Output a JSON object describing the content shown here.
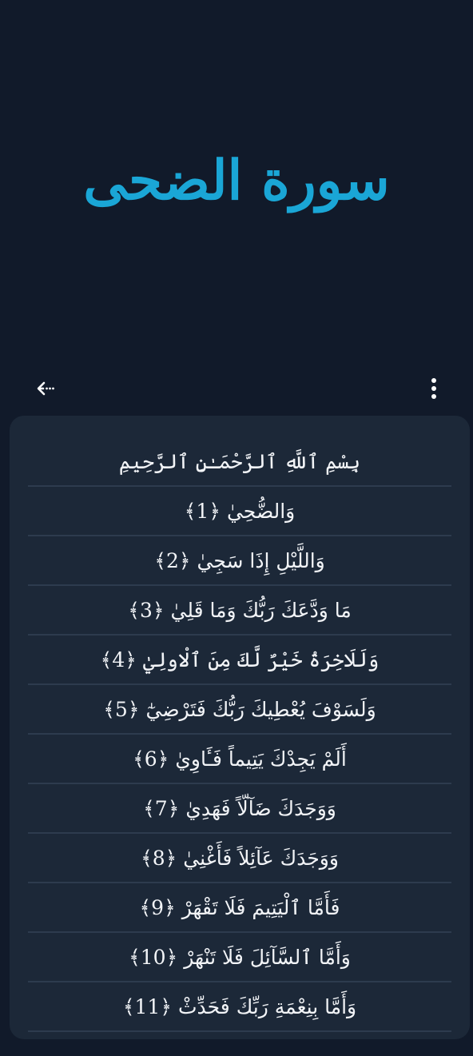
{
  "header": {
    "surah_title": "سورة الضحى"
  },
  "toolbar": {
    "back_icon": "back-arrow-icon",
    "menu_icon": "more-vertical-icon"
  },
  "ayahs": [
    {
      "text": "بِسْمِ ٱللَّهِ ٱلرَّحْمَـٰنِ ٱلرَّحِيمِ",
      "number": ""
    },
    {
      "text": "وَالضُّحِيٰ",
      "number": "﴿1﴾"
    },
    {
      "text": "وَاللَّيْلِ إِذَا سَجِيٰ",
      "number": "﴿2﴾"
    },
    {
      "text": "مَا وَدَّعَكَ رَبُّكَ وَمَا قَلِيٰ",
      "number": "﴿3﴾"
    },
    {
      "text": "وَلَلَاخِرَةُ خَيْرٌ لَّكَ مِنَ ٱلْاولِيٰ",
      "number": "﴿4﴾"
    },
    {
      "text": "وَلَسَوْفَ يُعْطِيكَ رَبُّكَ فَتَرْضِيٰٓ",
      "number": "﴿5﴾"
    },
    {
      "text": "أَلَمْ يَجِدْكَ يَتِيماً فَـَٔاوِيٰ",
      "number": "﴿6﴾"
    },
    {
      "text": "وَوَجَدَكَ ضَآلّاً فَهَدِيٰ",
      "number": "﴿7﴾"
    },
    {
      "text": "وَوَجَدَكَ عَآئِلاً فَأَغْنِيٰ",
      "number": "﴿8﴾"
    },
    {
      "text": "فَأَمَّا ٱلْيَتِيمَ فَلَا تَقْهَرْ",
      "number": "﴿9﴾"
    },
    {
      "text": "وَأَمَّا ٱلسَّآئِلَ فَلَا تَنْهَرْ",
      "number": "﴿10﴾"
    },
    {
      "text": "وَأَمَّا بِنِعْمَةِ رَبِّكَ فَحَدِّثْ",
      "number": "﴿11﴾"
    }
  ],
  "colors": {
    "background": "#111a2a",
    "card": "#1c2838",
    "title": "#1aa6d6",
    "divider": "#2d3b4e",
    "text": "#f2f4f7"
  }
}
